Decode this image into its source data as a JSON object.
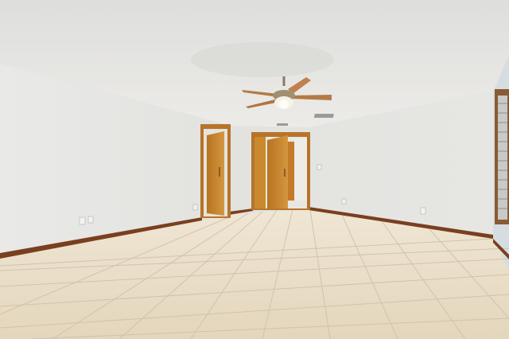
{
  "scene": {
    "description_colors": {
      "ceiling": "#e6e6e4",
      "left_wall": "#e8e8e6",
      "back_wall": "#e3e3e0",
      "right_wall": "#dde1e3",
      "floor": "#e8dcc6",
      "grout": "#cdbfa8",
      "baseboard": "#7a3f1f",
      "door": "#c98a2e",
      "door_frame": "#b7742a",
      "fan_blade": "#b57a45",
      "fan_light": "#f5f2e8"
    }
  }
}
